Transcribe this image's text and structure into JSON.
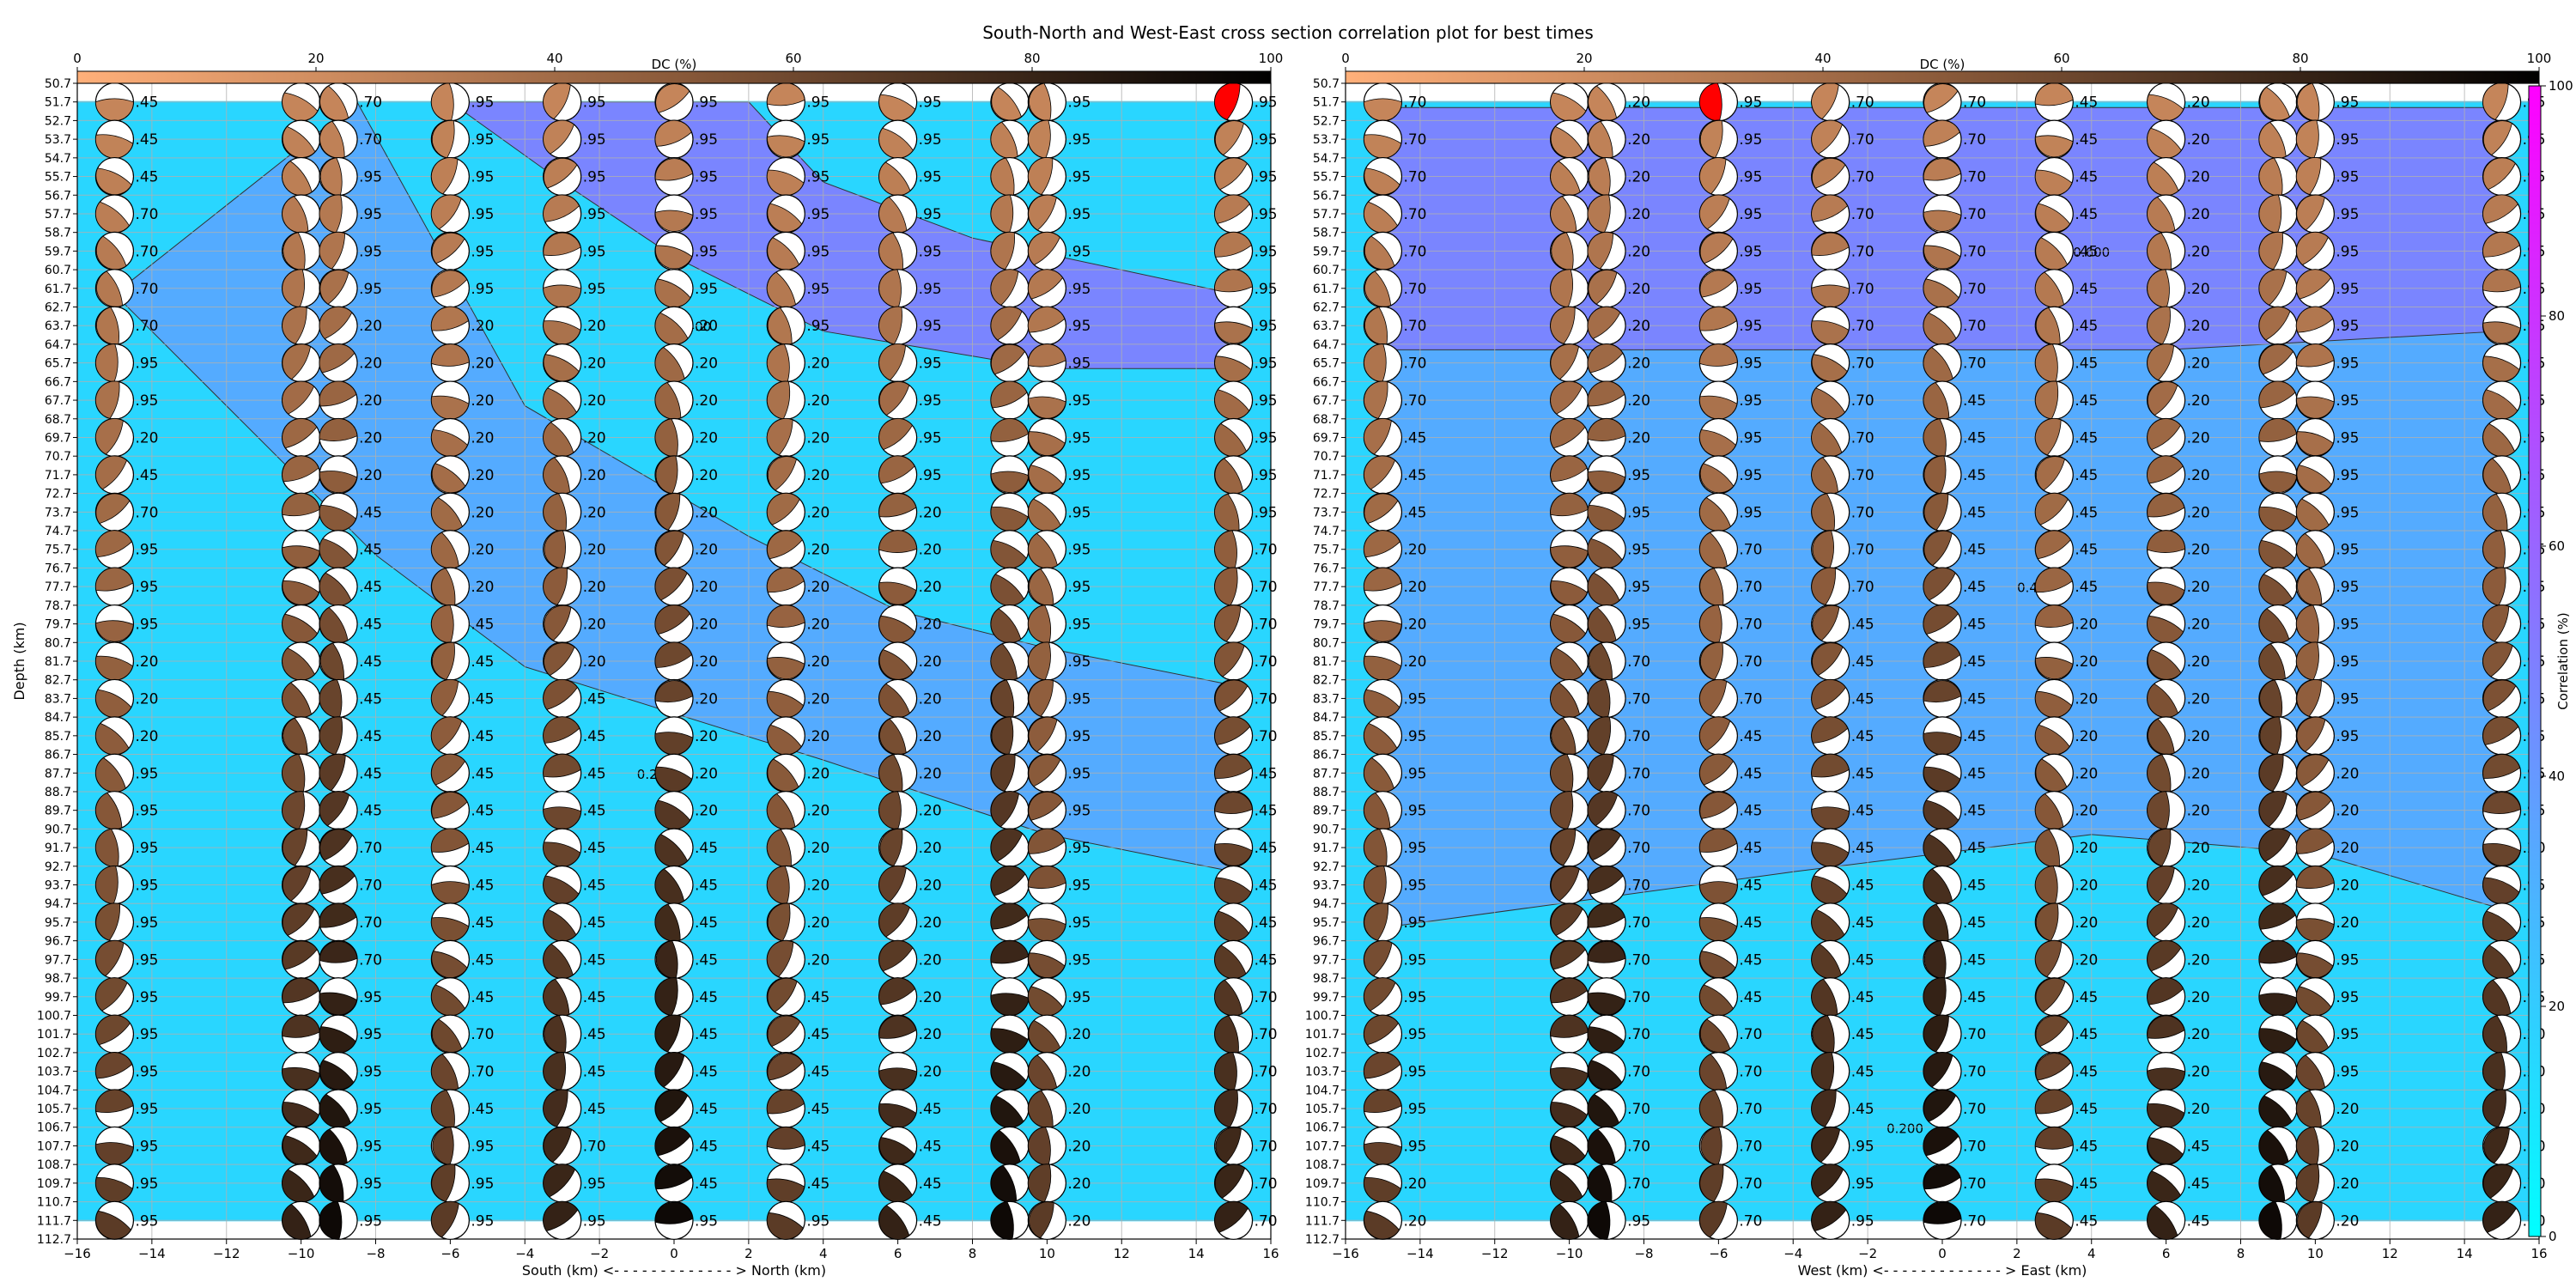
{
  "title": "South-North and West-East cross section correlation plot for best times",
  "colors": {
    "corr_low": "#00ffff",
    "corr_high": "#ff00ff",
    "dc_low": "#ffb07a",
    "dc_high": "#000000",
    "fill_best": "#ff0000",
    "grid": "#b0b0b0"
  },
  "chart_data": [
    {
      "type": "heatmap",
      "panel": "south-north",
      "xlabel": "South (km) <- - - - - - - - - - - - - > North (km)",
      "ylabel": "Depth (km)",
      "xlim": [
        -16,
        16
      ],
      "ylim": [
        50.7,
        112.7
      ],
      "xticks": [
        -16,
        -14,
        -12,
        -10,
        -8,
        -6,
        -4,
        -2,
        0,
        2,
        4,
        6,
        8,
        10,
        12,
        14,
        16
      ],
      "x": [
        -15,
        -10,
        -9,
        -6,
        -3,
        0,
        3,
        6,
        9,
        10,
        15
      ],
      "depths_first": 51.7,
      "depth_step": 2,
      "depth_count": 31,
      "contour_levels": [
        "0.200",
        "0.400"
      ],
      "best_solution": {
        "x": 15,
        "depth": 51.7
      },
      "labels": [
        [
          ".45",
          ".70",
          ".70",
          ".95",
          ".95",
          ".95",
          ".95",
          ".95",
          ".95",
          ".95",
          ".95"
        ],
        [
          ".45",
          ".70",
          ".70",
          ".95",
          ".95",
          ".95",
          ".95",
          ".95",
          ".95",
          ".95",
          ".95"
        ],
        [
          ".45",
          ".70",
          ".95",
          ".95",
          ".95",
          ".95",
          ".95",
          ".95",
          ".95",
          ".95",
          ".95"
        ],
        [
          ".70",
          ".70",
          ".95",
          ".95",
          ".95",
          ".95",
          ".95",
          ".95",
          ".95",
          ".95",
          ".95"
        ],
        [
          ".70",
          ".70",
          ".95",
          ".95",
          ".95",
          ".95",
          ".95",
          ".95",
          ".95",
          ".95",
          ".95"
        ],
        [
          ".70",
          ".70",
          ".95",
          ".95",
          ".95",
          ".95",
          ".95",
          ".95",
          ".95",
          ".95",
          ".95"
        ],
        [
          ".70",
          ".70",
          ".20",
          ".20",
          ".20",
          ".20",
          ".95",
          ".95",
          ".95",
          ".95",
          ".95"
        ],
        [
          ".95",
          ".70",
          ".20",
          ".20",
          ".20",
          ".20",
          ".20",
          ".95",
          ".95",
          ".95",
          ".95"
        ],
        [
          ".95",
          ".70",
          ".20",
          ".20",
          ".20",
          ".20",
          ".20",
          ".95",
          ".95",
          ".95",
          ".95"
        ],
        [
          ".20",
          ".20",
          ".20",
          ".20",
          ".20",
          ".20",
          ".20",
          ".95",
          ".95",
          ".95",
          ".95"
        ],
        [
          ".45",
          ".20",
          ".20",
          ".20",
          ".20",
          ".20",
          ".20",
          ".95",
          ".95",
          ".95",
          ".95"
        ],
        [
          ".70",
          ".45",
          ".45",
          ".20",
          ".20",
          ".20",
          ".20",
          ".20",
          ".95",
          ".95",
          ".95"
        ],
        [
          ".95",
          ".45",
          ".45",
          ".20",
          ".20",
          ".20",
          ".20",
          ".20",
          ".95",
          ".95",
          ".70"
        ],
        [
          ".95",
          ".45",
          ".45",
          ".20",
          ".20",
          ".20",
          ".20",
          ".20",
          ".95",
          ".95",
          ".70"
        ],
        [
          ".95",
          ".45",
          ".45",
          ".45",
          ".20",
          ".20",
          ".20",
          ".20",
          ".95",
          ".95",
          ".70"
        ],
        [
          ".20",
          ".45",
          ".45",
          ".45",
          ".20",
          ".20",
          ".20",
          ".20",
          ".95",
          ".95",
          ".70"
        ],
        [
          ".20",
          ".45",
          ".45",
          ".45",
          ".45",
          ".20",
          ".20",
          ".20",
          ".95",
          ".95",
          ".70"
        ],
        [
          ".20",
          ".45",
          ".45",
          ".45",
          ".45",
          ".20",
          ".20",
          ".20",
          ".95",
          ".95",
          ".70"
        ],
        [
          ".95",
          ".45",
          ".45",
          ".45",
          ".45",
          ".20",
          ".20",
          ".20",
          ".95",
          ".95",
          ".45"
        ],
        [
          ".95",
          ".45",
          ".45",
          ".45",
          ".45",
          ".20",
          ".20",
          ".20",
          ".95",
          ".95",
          ".45"
        ],
        [
          ".95",
          ".70",
          ".70",
          ".45",
          ".45",
          ".45",
          ".20",
          ".20",
          ".95",
          ".95",
          ".45"
        ],
        [
          ".95",
          ".70",
          ".70",
          ".45",
          ".45",
          ".45",
          ".20",
          ".20",
          ".95",
          ".95",
          ".45"
        ],
        [
          ".95",
          ".70",
          ".70",
          ".45",
          ".45",
          ".45",
          ".20",
          ".20",
          ".95",
          ".95",
          ".45"
        ],
        [
          ".95",
          ".70",
          ".70",
          ".45",
          ".45",
          ".45",
          ".20",
          ".20",
          ".95",
          ".95",
          ".45"
        ],
        [
          ".95",
          ".95",
          ".95",
          ".45",
          ".45",
          ".45",
          ".45",
          ".20",
          ".95",
          ".95",
          ".70"
        ],
        [
          ".95",
          ".95",
          ".95",
          ".70",
          ".45",
          ".45",
          ".45",
          ".20",
          ".20",
          ".20",
          ".70"
        ],
        [
          ".95",
          ".95",
          ".95",
          ".70",
          ".45",
          ".45",
          ".45",
          ".20",
          ".20",
          ".20",
          ".70"
        ],
        [
          ".95",
          ".95",
          ".95",
          ".45",
          ".45",
          ".45",
          ".45",
          ".45",
          ".20",
          ".20",
          ".70"
        ],
        [
          ".95",
          ".95",
          ".95",
          ".95",
          ".70",
          ".45",
          ".45",
          ".45",
          ".20",
          ".20",
          ".70"
        ],
        [
          ".95",
          ".95",
          ".95",
          ".95",
          ".95",
          ".45",
          ".45",
          ".45",
          ".20",
          ".20",
          ".70"
        ],
        [
          ".95",
          ".95",
          ".95",
          ".95",
          ".95",
          ".95",
          ".95",
          ".45",
          ".20",
          ".20",
          ".70"
        ]
      ]
    },
    {
      "type": "heatmap",
      "panel": "west-east",
      "xlabel": "West (km) <- - - - - - - - - - - - - > East (km)",
      "ylabel": "",
      "xlim": [
        -16,
        16
      ],
      "ylim": [
        50.7,
        112.7
      ],
      "xticks": [
        -16,
        -14,
        -12,
        -10,
        -8,
        -6,
        -4,
        -2,
        0,
        2,
        4,
        6,
        8,
        10,
        12,
        14,
        16
      ],
      "x": [
        -15,
        -10,
        -9,
        -6,
        -3,
        0,
        3,
        6,
        9,
        10,
        15
      ],
      "depths_first": 51.7,
      "depth_step": 2,
      "depth_count": 31,
      "contour_levels": [
        "0.600",
        "0.400",
        "0.200"
      ],
      "best_solution": {
        "x": -6,
        "depth": 51.7
      },
      "labels": [
        [
          ".70",
          ".20",
          ".20",
          ".95",
          ".70",
          ".70",
          ".45",
          ".20",
          ".95",
          ".95",
          ".95"
        ],
        [
          ".70",
          ".20",
          ".20",
          ".95",
          ".70",
          ".70",
          ".45",
          ".20",
          ".95",
          ".95",
          ".95"
        ],
        [
          ".70",
          ".20",
          ".20",
          ".95",
          ".70",
          ".70",
          ".45",
          ".20",
          ".95",
          ".95",
          ".95"
        ],
        [
          ".70",
          ".20",
          ".20",
          ".95",
          ".70",
          ".70",
          ".45",
          ".20",
          ".95",
          ".95",
          ".95"
        ],
        [
          ".70",
          ".20",
          ".20",
          ".95",
          ".70",
          ".70",
          ".45",
          ".20",
          ".95",
          ".95",
          ".95"
        ],
        [
          ".70",
          ".20",
          ".20",
          ".95",
          ".70",
          ".70",
          ".45",
          ".20",
          ".95",
          ".95",
          ".95"
        ],
        [
          ".70",
          ".20",
          ".20",
          ".95",
          ".70",
          ".70",
          ".45",
          ".20",
          ".95",
          ".95",
          ".95"
        ],
        [
          ".70",
          ".20",
          ".20",
          ".95",
          ".70",
          ".70",
          ".45",
          ".20",
          ".95",
          ".95",
          ".95"
        ],
        [
          ".70",
          ".20",
          ".20",
          ".95",
          ".70",
          ".45",
          ".45",
          ".20",
          ".95",
          ".95",
          ".95"
        ],
        [
          ".45",
          ".20",
          ".20",
          ".95",
          ".70",
          ".45",
          ".45",
          ".20",
          ".95",
          ".95",
          ".95"
        ],
        [
          ".45",
          ".95",
          ".95",
          ".95",
          ".70",
          ".45",
          ".45",
          ".20",
          ".95",
          ".95",
          ".95"
        ],
        [
          ".45",
          ".95",
          ".95",
          ".95",
          ".70",
          ".45",
          ".45",
          ".20",
          ".95",
          ".95",
          ".95"
        ],
        [
          ".20",
          ".95",
          ".95",
          ".70",
          ".70",
          ".45",
          ".45",
          ".20",
          ".95",
          ".95",
          ".95"
        ],
        [
          ".20",
          ".95",
          ".95",
          ".70",
          ".70",
          ".45",
          ".45",
          ".20",
          ".95",
          ".95",
          ".95"
        ],
        [
          ".20",
          ".95",
          ".95",
          ".70",
          ".45",
          ".45",
          ".20",
          ".20",
          ".95",
          ".95",
          ".95"
        ],
        [
          ".20",
          ".70",
          ".70",
          ".70",
          ".45",
          ".45",
          ".20",
          ".20",
          ".95",
          ".95",
          ".95"
        ],
        [
          ".95",
          ".70",
          ".70",
          ".70",
          ".45",
          ".45",
          ".20",
          ".20",
          ".95",
          ".95",
          ".95"
        ],
        [
          ".95",
          ".70",
          ".70",
          ".45",
          ".45",
          ".45",
          ".20",
          ".20",
          ".95",
          ".95",
          ".95"
        ],
        [
          ".95",
          ".70",
          ".70",
          ".45",
          ".45",
          ".45",
          ".20",
          ".20",
          ".20",
          ".20",
          ".95"
        ],
        [
          ".95",
          ".70",
          ".70",
          ".45",
          ".45",
          ".45",
          ".20",
          ".20",
          ".20",
          ".20",
          ".95"
        ],
        [
          ".95",
          ".70",
          ".70",
          ".45",
          ".45",
          ".45",
          ".20",
          ".20",
          ".20",
          ".20",
          ".20"
        ],
        [
          ".95",
          ".70",
          ".70",
          ".45",
          ".45",
          ".45",
          ".20",
          ".20",
          ".20",
          ".20",
          ".95"
        ],
        [
          ".95",
          ".70",
          ".70",
          ".45",
          ".45",
          ".45",
          ".20",
          ".20",
          ".20",
          ".20",
          ".95"
        ],
        [
          ".95",
          ".70",
          ".70",
          ".45",
          ".45",
          ".45",
          ".20",
          ".20",
          ".95",
          ".95",
          ".95"
        ],
        [
          ".95",
          ".70",
          ".70",
          ".45",
          ".45",
          ".45",
          ".45",
          ".20",
          ".95",
          ".95",
          ".95"
        ],
        [
          ".95",
          ".70",
          ".70",
          ".70",
          ".45",
          ".70",
          ".45",
          ".20",
          ".95",
          ".95",
          ".20"
        ],
        [
          ".95",
          ".70",
          ".70",
          ".70",
          ".45",
          ".70",
          ".45",
          ".20",
          ".95",
          ".95",
          ".20"
        ],
        [
          ".95",
          ".70",
          ".70",
          ".70",
          ".45",
          ".70",
          ".45",
          ".20",
          ".20",
          ".20",
          ".70"
        ],
        [
          ".95",
          ".70",
          ".70",
          ".70",
          ".95",
          ".70",
          ".45",
          ".45",
          ".20",
          ".20",
          ".70"
        ],
        [
          ".20",
          ".70",
          ".70",
          ".70",
          ".95",
          ".70",
          ".45",
          ".45",
          ".20",
          ".20",
          ".70"
        ],
        [
          ".20",
          ".95",
          ".95",
          ".70",
          ".95",
          ".70",
          ".45",
          ".45",
          ".20",
          ".20",
          ".70"
        ]
      ]
    }
  ],
  "top_colorbar": {
    "label": "DC (%)",
    "ticks": [
      0,
      20,
      40,
      60,
      80,
      100
    ]
  },
  "side_colorbar": {
    "label": "Correlation (%)",
    "ticks": [
      0,
      20,
      40,
      60,
      80,
      100
    ]
  }
}
